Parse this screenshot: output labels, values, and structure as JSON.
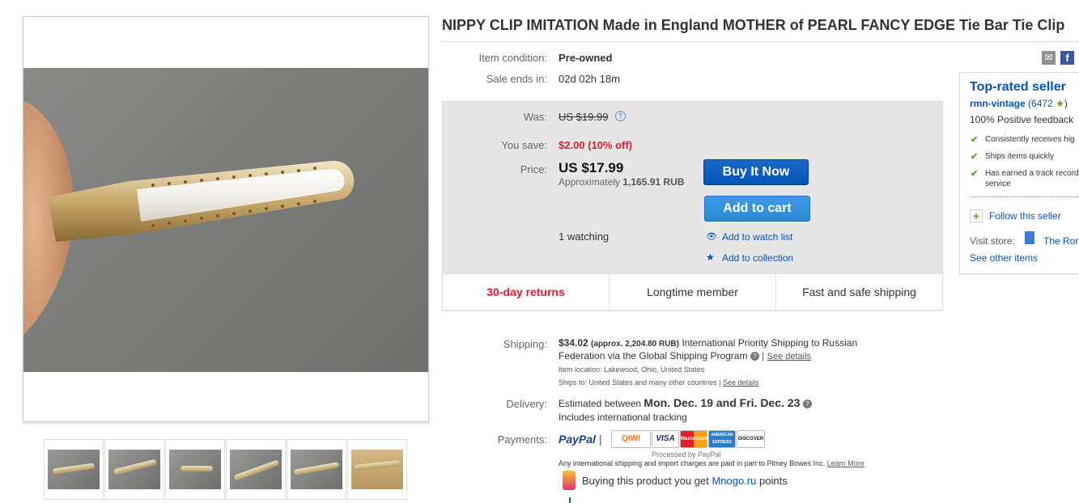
{
  "listing": {
    "title": "NIPPY CLIP IMITATION Made in England MOTHER of PEARL FANCY EDGE Tie Bar Tie Clip"
  },
  "details": {
    "condition_label": "Item condition:",
    "condition_value": "Pre-owned",
    "ends_label": "Sale ends in:",
    "ends_value": "02d 02h 18m"
  },
  "pricing": {
    "was_label": "Was:",
    "was_value": "US $19.99",
    "save_label": "You save:",
    "save_value": "$2.00 (10% off)",
    "price_label": "Price:",
    "price_value": "US $17.99",
    "approx_prefix": "Approximately",
    "approx_value": "1,165.91 RUB",
    "buy_now_label": "Buy It Now",
    "add_to_cart_label": "Add to cart",
    "watching": "1 watching",
    "watch_list_label": "Add to watch list",
    "collection_label": "Add to collection",
    "strip": [
      "30-day returns",
      "Longtime member",
      "Fast and safe shipping"
    ]
  },
  "shipping": {
    "label": "Shipping:",
    "cost": "$34.02",
    "approx": "(approx. 2,204.80 RUB)",
    "service_line1": "International Priority Shipping to Russian",
    "service_line2": "Federation  via the Global Shipping Program",
    "see_details": "See details",
    "location_label": "Item location:",
    "location_value": "Lakewood, Ohio, United States",
    "ships_to_label": "Ships to:",
    "ships_to_value": "United States and many other countries",
    "ships_to_details": "See details"
  },
  "delivery": {
    "label": "Delivery:",
    "prefix": "Estimated between",
    "range": "Mon. Dec. 19 and Fri. Dec. 23",
    "tracking": "Includes international tracking"
  },
  "payments": {
    "label": "Payments:",
    "paypal": "PayPal",
    "logos": [
      "QIWI",
      "VISA",
      "MasterCard",
      "AMERICAN EXPRESS",
      "DISCOVER"
    ],
    "processed_by": "Processed by PayPal",
    "import_note": "Any international shipping and import charges are paid in part to Pitney Bowes Inc.",
    "learn_more": "Learn More",
    "mnogo_prefix": "Buying this product you get",
    "mnogo_link": "Mnogo.ru",
    "mnogo_suffix": "points"
  },
  "seller": {
    "heading": "Top-rated seller",
    "name": "rmn-vintage",
    "feedback_count": "(6472",
    "feedback_close": ")",
    "positive": "100% Positive feedback",
    "bullets": [
      "Consistently receives hig",
      "Ships items quickly",
      "Has earned a track record",
      "service"
    ],
    "follow": "Follow this seller",
    "visit_label": "Visit store:",
    "store_name": "The Ror",
    "other_items": "See other items"
  },
  "colors": {
    "link": "#0654ba",
    "accent_red": "#dd1e31",
    "buy_now": "#0654ba",
    "positive_green": "#5ba71b"
  }
}
